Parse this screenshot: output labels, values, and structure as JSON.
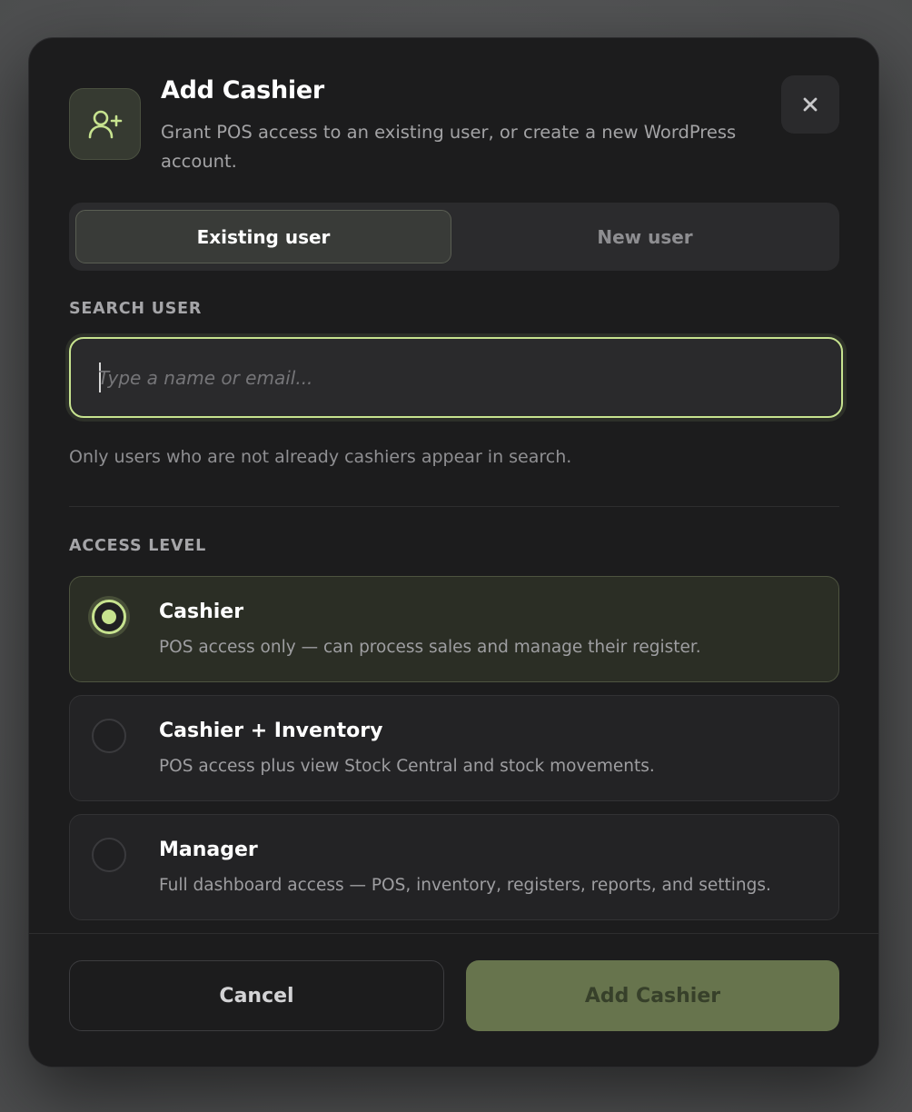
{
  "modal": {
    "title": "Add Cashier",
    "subtitle": "Grant POS access to an existing user, or create a new WordPress account.",
    "header_icon": "user-plus-icon",
    "close_icon": "close-icon"
  },
  "tabs": [
    {
      "label": "Existing user",
      "active": true
    },
    {
      "label": "New user",
      "active": false
    }
  ],
  "search": {
    "label": "SEARCH USER",
    "placeholder": "Type a name or email...",
    "value": "",
    "help": "Only users who are not already cashiers appear in search."
  },
  "access": {
    "label": "ACCESS LEVEL",
    "options": [
      {
        "title": "Cashier",
        "description": "POS access only — can process sales and manage their register.",
        "selected": true
      },
      {
        "title": "Cashier + Inventory",
        "description": "POS access plus view Stock Central and stock movements.",
        "selected": false
      },
      {
        "title": "Manager",
        "description": "Full dashboard access — POS, inventory, registers, reports, and settings.",
        "selected": false
      }
    ]
  },
  "footer": {
    "cancel_label": "Cancel",
    "submit_label": "Add Cashier"
  },
  "colors": {
    "accent": "#c7e38f",
    "primary_button": "#67744d",
    "modal_bg": "#1c1c1d"
  }
}
